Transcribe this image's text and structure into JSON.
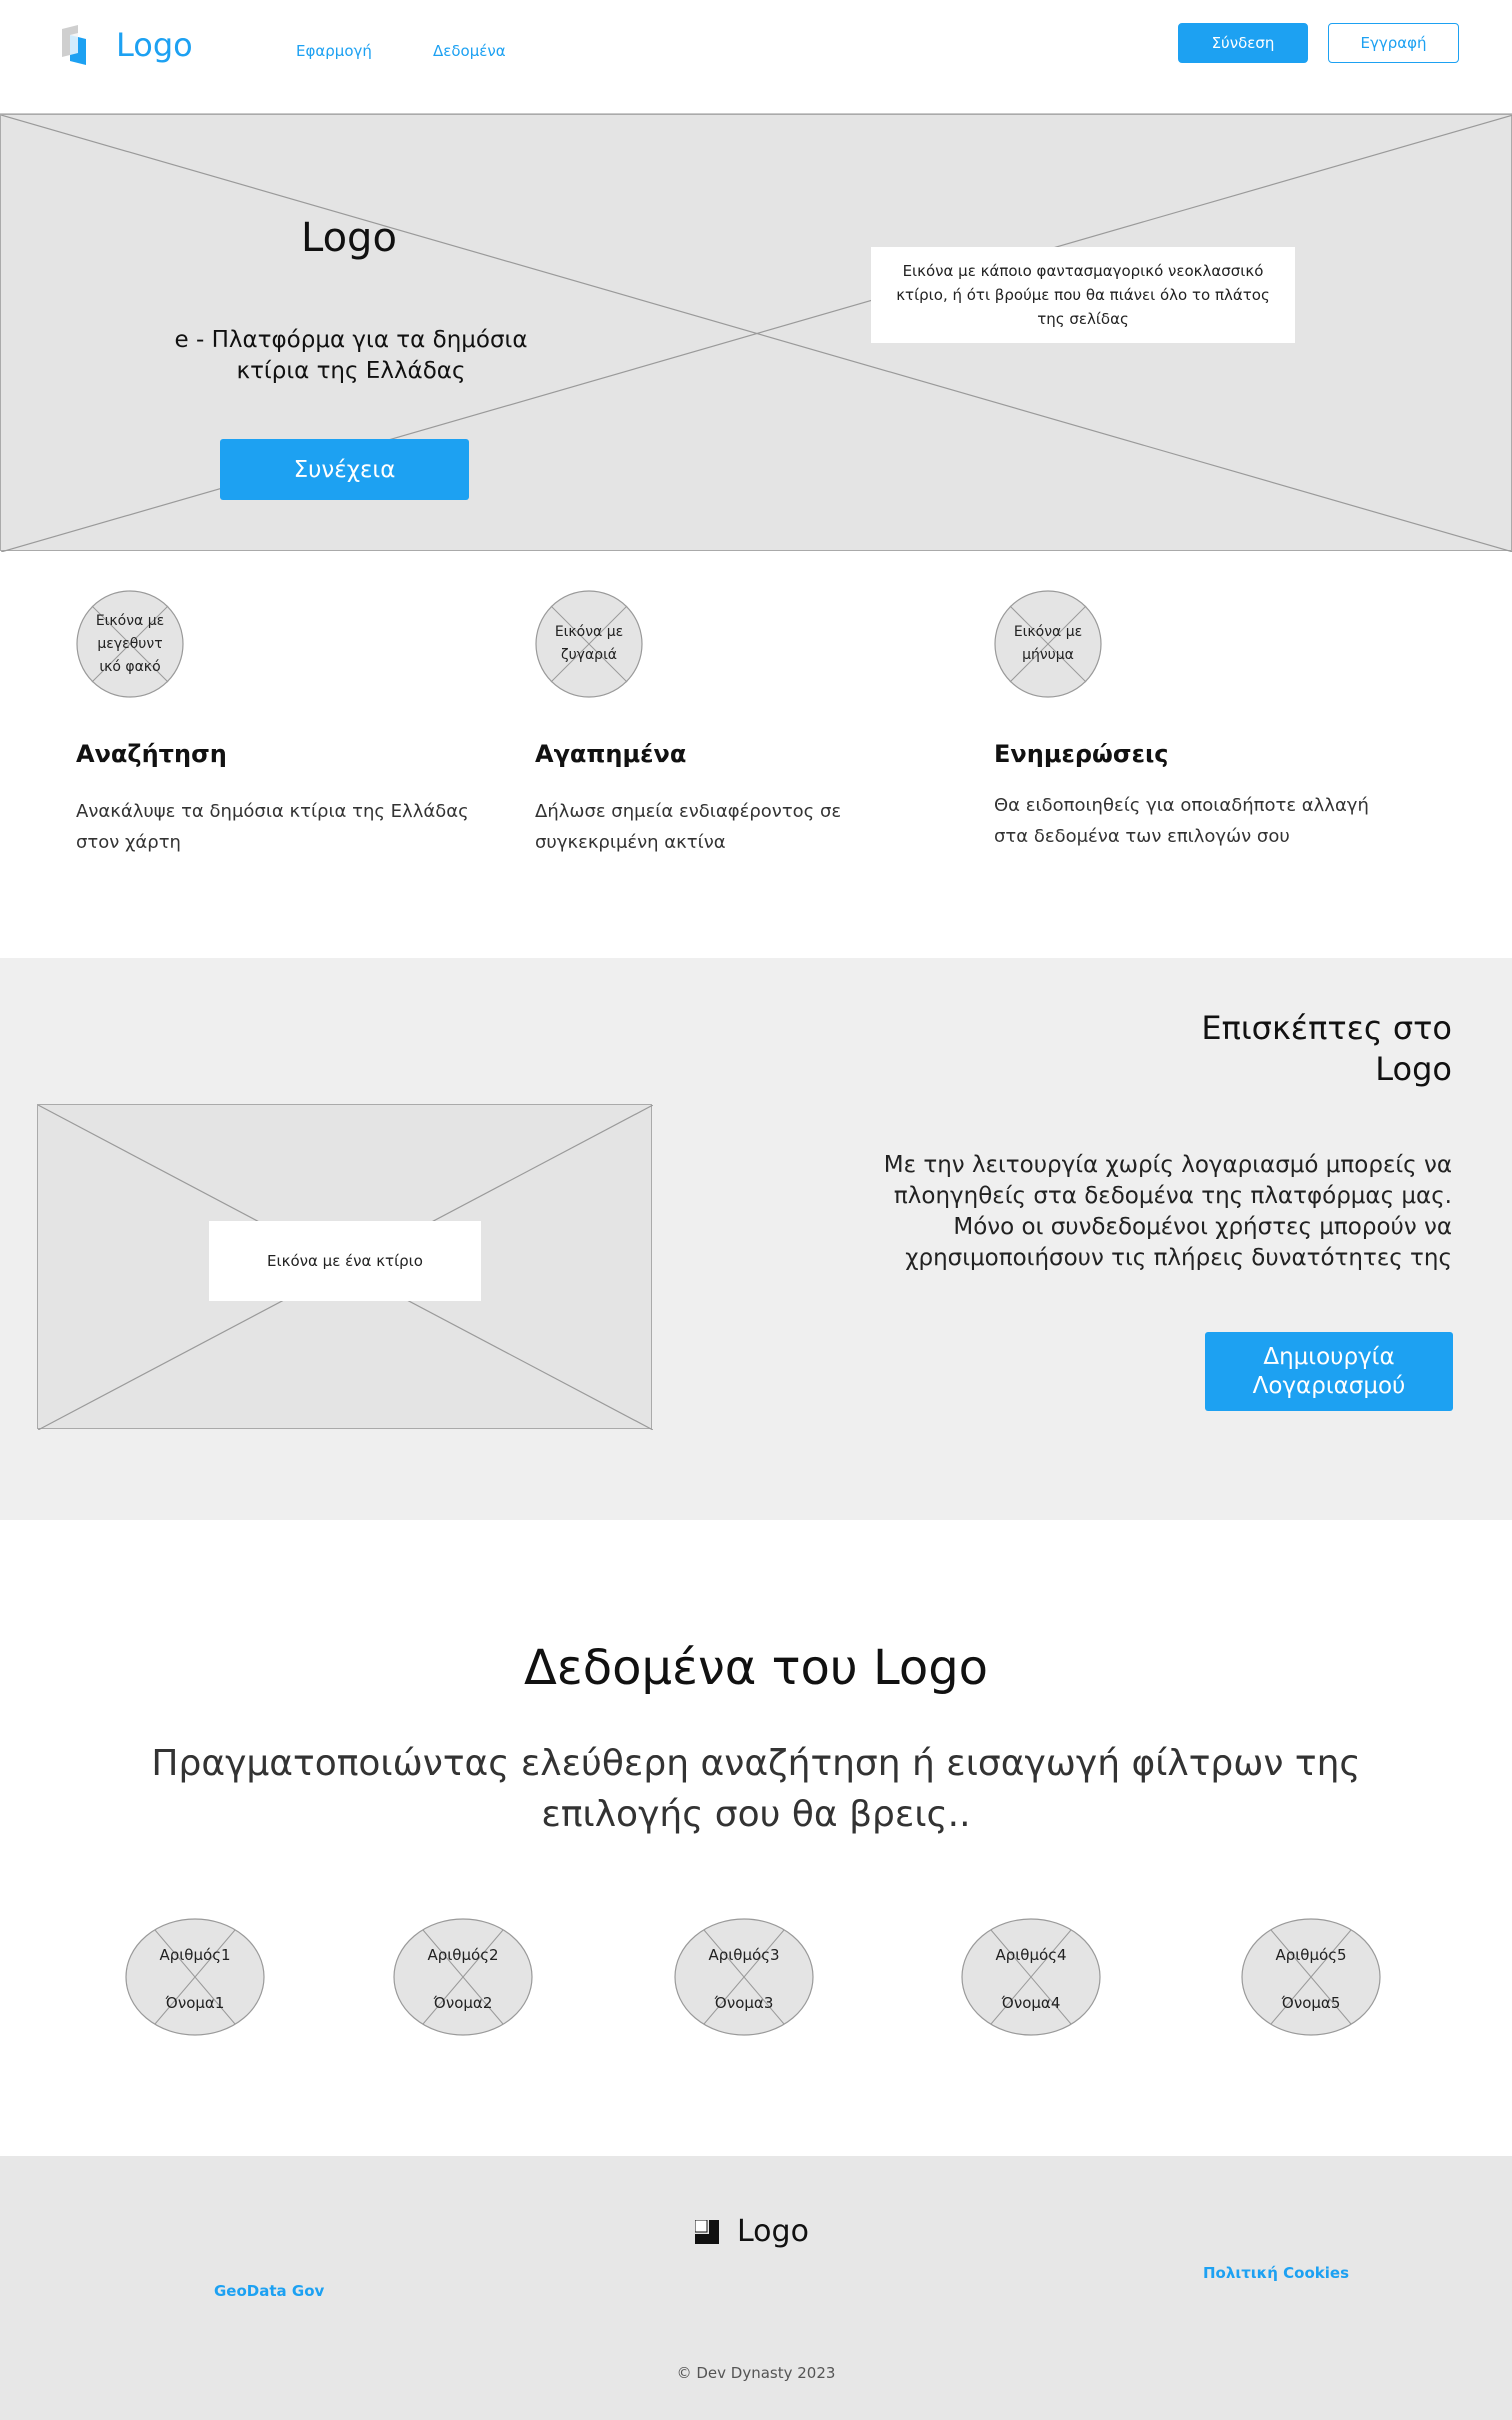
{
  "header": {
    "logo_text": "Logo",
    "nav": [
      "Εφαρμογή",
      "Δεδομένα"
    ],
    "login_label": "Σύνδεση",
    "register_label": "Εγγραφή"
  },
  "hero": {
    "logo_text": "Logo",
    "subtitle": "e - Πλατφόρμα για τα δημόσια κτίρια της Ελλάδας",
    "cta_label": "Συνέχεια",
    "image_caption": "Εικόνα με κάποιο φαντασμαγορικό νεοκλασσικό κτίριο, ή ότι βρούμε που θα πιάνει όλο το πλάτος της σελίδας"
  },
  "features": [
    {
      "icon_label": "Εικόνα με μεγεθυντ ικό φακό",
      "title": "Αναζήτηση",
      "desc": "Ανακάλυψε τα δημόσια κτίρια της Ελλάδας στον χάρτη"
    },
    {
      "icon_label": "Εικόνα με ζυγαριά",
      "title": "Αγαπημένα",
      "desc": "Δήλωσε σημεία ενδιαφέροντος σε συγκεκριμένη ακτίνα"
    },
    {
      "icon_label": "Εικόνα με μήνυμα",
      "title": "Ενημερώσεις",
      "desc": "Θα ειδοποιηθείς για οποιαδήποτε αλλαγή στα δεδομένα των επιλογών σου"
    }
  ],
  "visitors": {
    "title": "Επισκέπτες στο Logo",
    "text": "Με την λειτουργία χωρίς λογαριασμό μπορείς να πλοηγηθείς στα δεδομένα της πλατφόρμας μας. Μόνο οι συνδεδομένοι χρήστες μπορούν να χρησιμοποιήσουν τις πλήρεις δυνατότητες της",
    "image_caption": "Εικόνα με ένα κτίριο",
    "cta_label": "Δημιουργία Λογαριασμού"
  },
  "data_section": {
    "title": "Δεδομένα του Logo",
    "subtitle": "Πραγματοποιώντας ελεύθερη αναζήτηση ή εισαγωγή φίλτρων της επιλογής σου θα βρεις..",
    "stats": [
      {
        "number": "Αριθμός1",
        "name": "Όνομα1"
      },
      {
        "number": "Αριθμός2",
        "name": "Όνομα2"
      },
      {
        "number": "Αριθμός3",
        "name": "Όνομα3"
      },
      {
        "number": "Αριθμός4",
        "name": "Όνομα4"
      },
      {
        "number": "Αριθμός5",
        "name": "Όνομα5"
      }
    ]
  },
  "footer": {
    "logo_text": "Logo",
    "link_left": "GeoData Gov",
    "link_right": "Πολιτική Cookies",
    "copyright": "© Dev Dynasty 2023"
  },
  "colors": {
    "accent": "#1da1f2",
    "placeholder_bg": "#e4e4e4",
    "section_bg": "#efefef",
    "footer_bg": "#e7e7e7"
  }
}
